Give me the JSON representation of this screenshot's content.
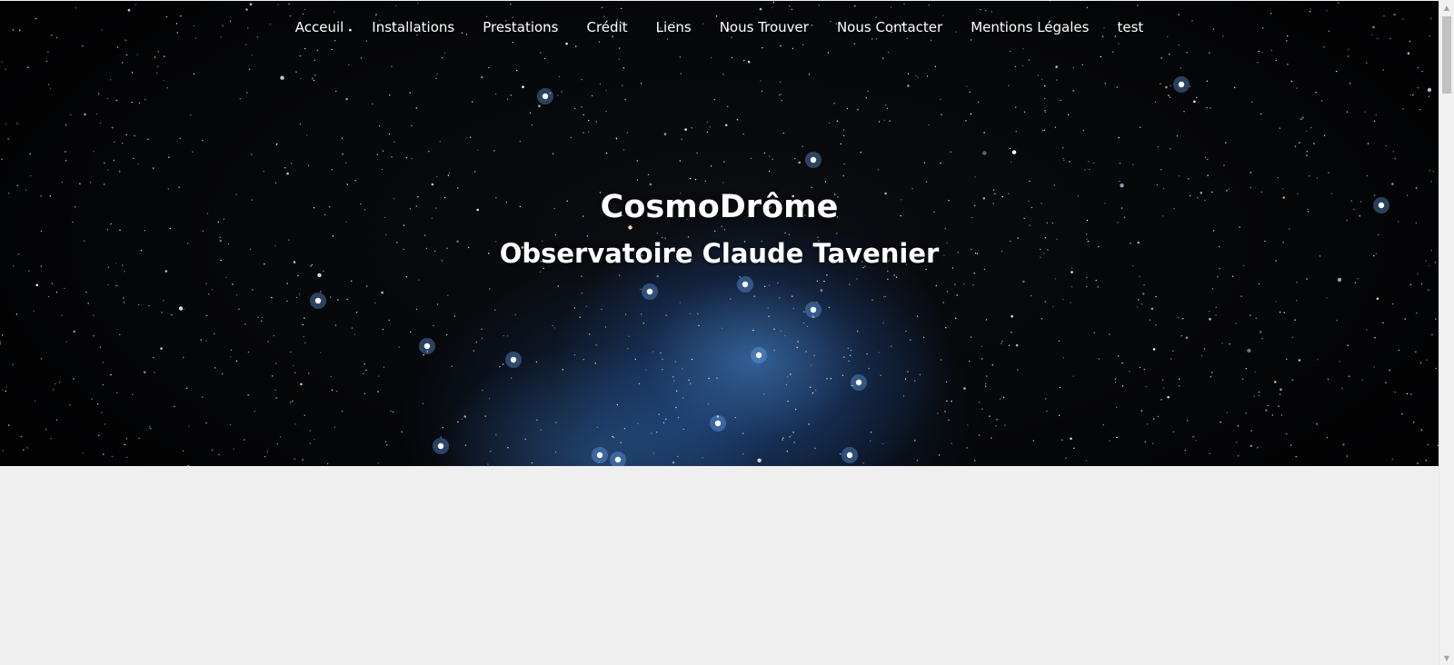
{
  "nav": {
    "items": [
      {
        "label": "Acceuil"
      },
      {
        "label": "Installations"
      },
      {
        "label": "Prestations"
      },
      {
        "label": "Crédit"
      },
      {
        "label": "Liens"
      },
      {
        "label": "Nous Trouver"
      },
      {
        "label": "Nous Contacter"
      },
      {
        "label": "Mentions Légales"
      },
      {
        "label": "test"
      }
    ]
  },
  "hero": {
    "title": "CosmoDrôme",
    "subtitle": "Observatoire Claude Tavenier",
    "background": "star-field-pleiades-image"
  },
  "colors": {
    "page_background": "#efefef",
    "hero_background": "#050608",
    "nebula_blue": "#5096e6",
    "text": "#ffffff"
  }
}
